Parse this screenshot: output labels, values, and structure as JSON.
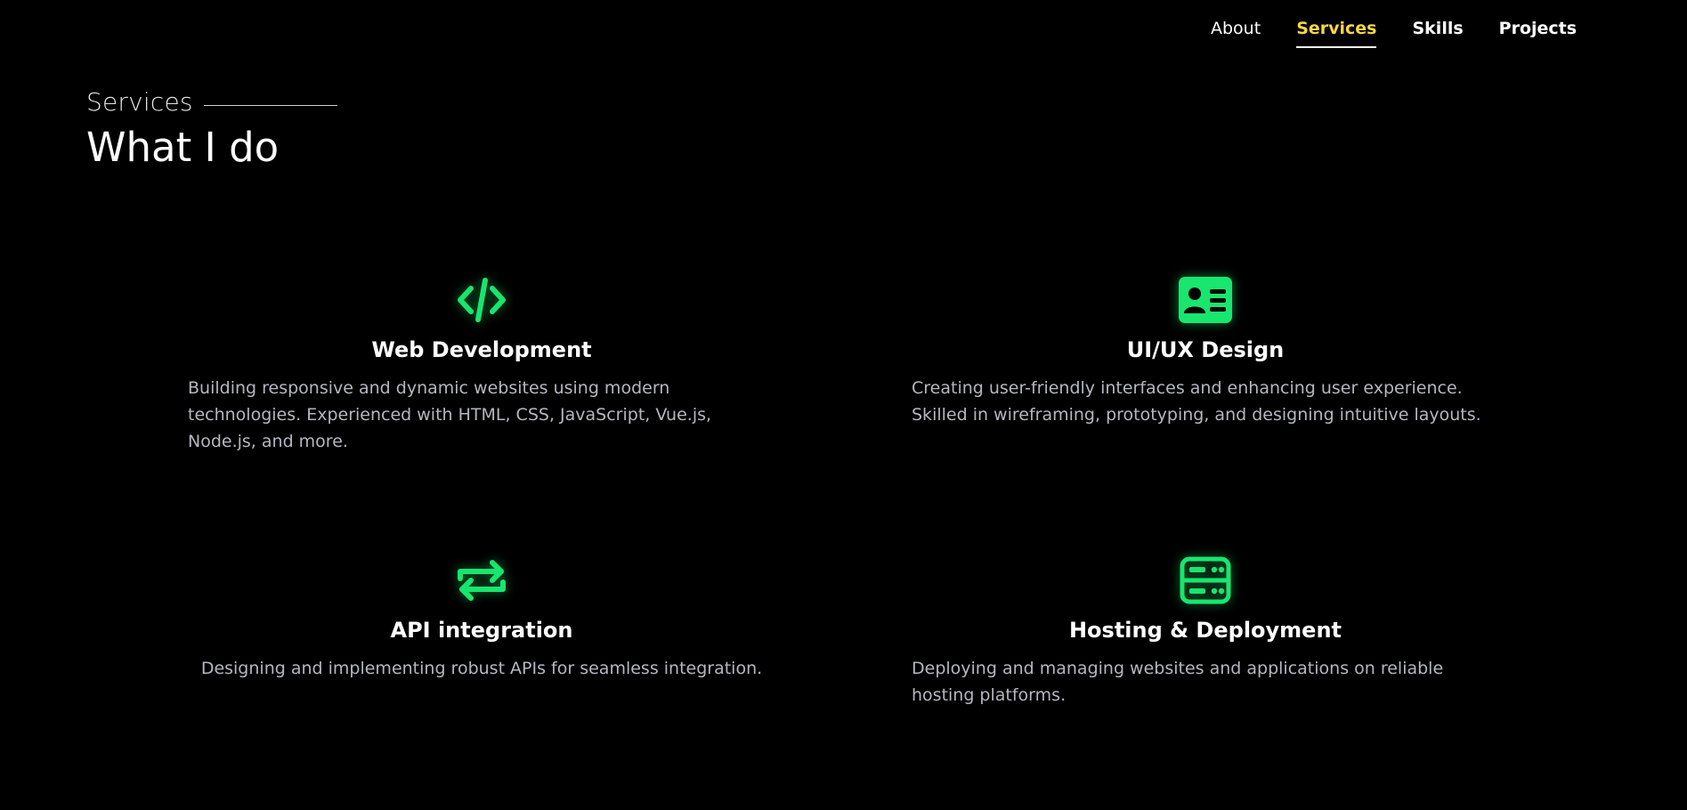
{
  "nav": {
    "items": [
      {
        "label": "About"
      },
      {
        "label": "Services"
      },
      {
        "label": "Skills"
      },
      {
        "label": "Projects"
      }
    ],
    "active": "Services",
    "active_color": "#f5d547"
  },
  "section": {
    "eyebrow": "Services",
    "headline": "What I do"
  },
  "accent_color": "#18e66e",
  "services": [
    {
      "icon": "code-icon",
      "title": "Web Development",
      "description": "Building responsive and dynamic websites using modern technologies. Experienced with HTML, CSS, JavaScript, Vue.js, Node.js, and more."
    },
    {
      "icon": "id-card-icon",
      "title": "UI/UX Design",
      "description": "Creating user-friendly interfaces and enhancing user experience. Skilled in wireframing, prototyping, and designing intuitive layouts."
    },
    {
      "icon": "swap-arrows-icon",
      "title": "API integration",
      "description": "Designing and implementing robust APIs for seamless integration."
    },
    {
      "icon": "server-icon",
      "title": "Hosting & Deployment",
      "description": "Deploying and managing websites and applications on reliable hosting platforms."
    }
  ]
}
